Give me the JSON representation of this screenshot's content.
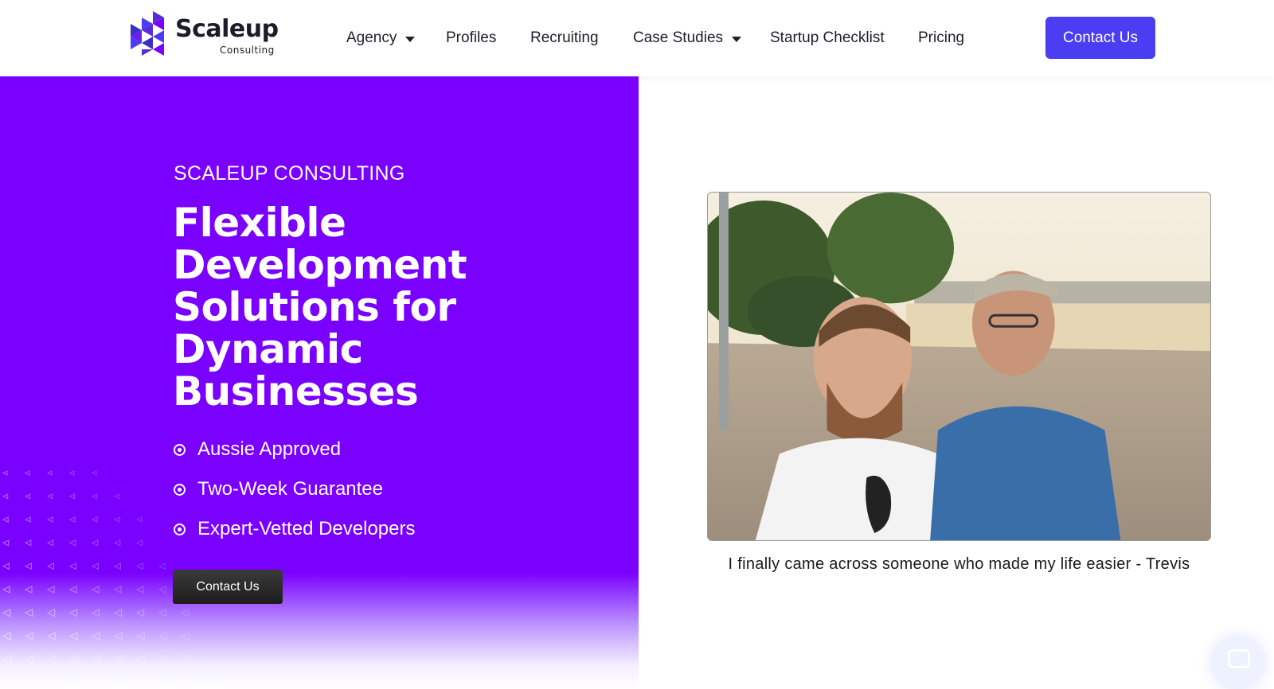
{
  "header": {
    "logo": {
      "name": "Scaleup",
      "subtitle": "Consulting"
    },
    "nav": [
      {
        "label": "Agency",
        "has_dropdown": true
      },
      {
        "label": "Profiles",
        "has_dropdown": false
      },
      {
        "label": "Recruiting",
        "has_dropdown": false
      },
      {
        "label": "Case Studies",
        "has_dropdown": true
      },
      {
        "label": "Startup Checklist",
        "has_dropdown": false
      },
      {
        "label": "Pricing",
        "has_dropdown": false
      }
    ],
    "cta_label": "Contact Us"
  },
  "hero": {
    "eyebrow": "SCALEUP CONSULTING",
    "headline_lines": [
      "Flexible",
      "Development",
      "Solutions for",
      "Dynamic",
      "Businesses"
    ],
    "features": [
      "Aussie Approved",
      "Two-Week Guarantee",
      "Expert-Vetted Developers"
    ],
    "cta_label": "Contact Us"
  },
  "testimonial": {
    "caption": "I finally came across someone who made my life easier - Trevis"
  },
  "colors": {
    "brand_purple": "#7a00ff",
    "button_blue": "#4b3df2",
    "hero_button": "#2b2b2b"
  },
  "icons": {
    "feature_bullet": "radio-dot-icon",
    "dropdown": "caret-down-icon",
    "chat": "chat-bubble-icon"
  }
}
